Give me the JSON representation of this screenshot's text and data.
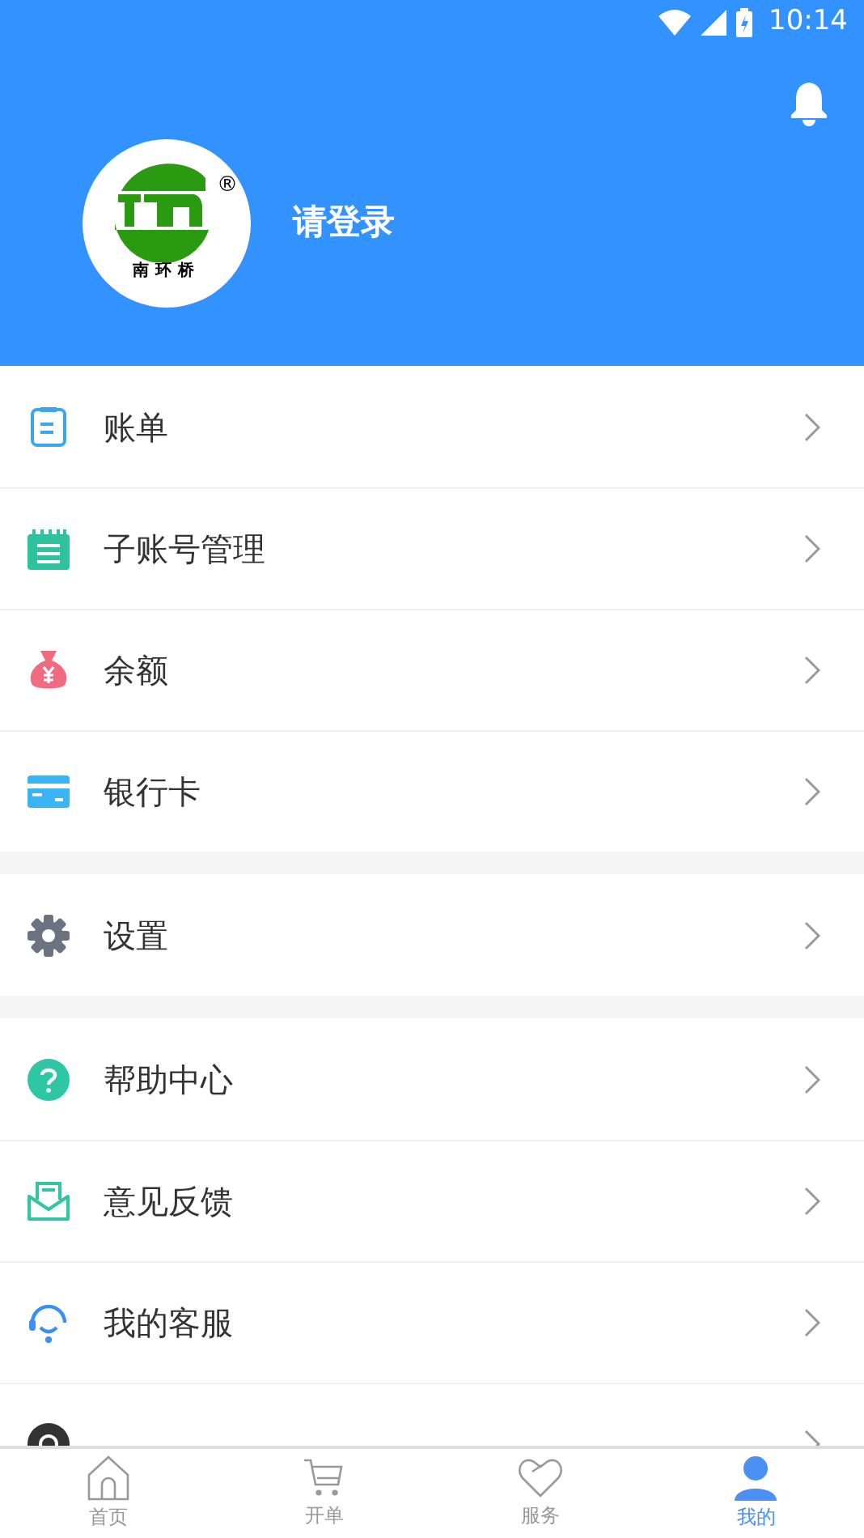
{
  "status_bar": {
    "time": "10:14"
  },
  "profile": {
    "logo_text": "南环桥",
    "logo_mark": "®",
    "login_prompt": "请登录"
  },
  "menu_groups": [
    {
      "items": [
        {
          "label": "账单",
          "kind": "bill"
        },
        {
          "label": "子账号管理",
          "kind": "notebook"
        },
        {
          "label": "余额",
          "kind": "moneybag"
        },
        {
          "label": "银行卡",
          "kind": "card"
        }
      ]
    },
    {
      "items": [
        {
          "label": "设置",
          "kind": "gear"
        }
      ]
    },
    {
      "items": [
        {
          "label": "帮助中心",
          "kind": "help"
        },
        {
          "label": "意见反馈",
          "kind": "mail"
        },
        {
          "label": "我的客服",
          "kind": "headset"
        },
        {
          "kind": "update"
        }
      ]
    }
  ],
  "tab_bar": [
    {
      "label": "首页",
      "kind": "home",
      "selected": false
    },
    {
      "label": "开单",
      "kind": "cart",
      "selected": false
    },
    {
      "label": "服务",
      "kind": "heart",
      "selected": false
    },
    {
      "label": "我的",
      "kind": "person",
      "selected": true
    }
  ]
}
